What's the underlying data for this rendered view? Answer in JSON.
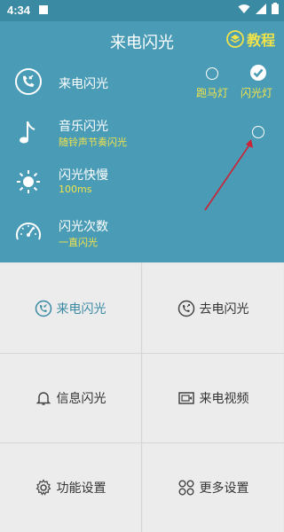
{
  "status": {
    "time": "4:34"
  },
  "header": {
    "title": "来电闪光",
    "tutorial_label": "教程"
  },
  "settings": {
    "incoming": {
      "label": "来电闪光",
      "options": [
        {
          "label": "跑马灯",
          "selected": false
        },
        {
          "label": "闪光灯",
          "selected": true
        }
      ]
    },
    "music": {
      "label": "音乐闪光",
      "sub": "随铃声节奏闪光"
    },
    "speed": {
      "label": "闪光快慢",
      "sub": "100ms"
    },
    "count": {
      "label": "闪光次数",
      "sub": "一直闪光"
    }
  },
  "menu": [
    {
      "label": "来电闪光",
      "icon": "phone-in-icon",
      "active": true
    },
    {
      "label": "去电闪光",
      "icon": "phone-out-icon",
      "active": false
    },
    {
      "label": "信息闪光",
      "icon": "bell-icon",
      "active": false
    },
    {
      "label": "来电视频",
      "icon": "video-icon",
      "active": false
    },
    {
      "label": "功能设置",
      "icon": "gear-icon",
      "active": false
    },
    {
      "label": "更多设置",
      "icon": "more-icon",
      "active": false
    }
  ],
  "colors": {
    "primary": "#4a9cb6",
    "accent": "#f0e34a",
    "annotation": "#cc2233"
  }
}
